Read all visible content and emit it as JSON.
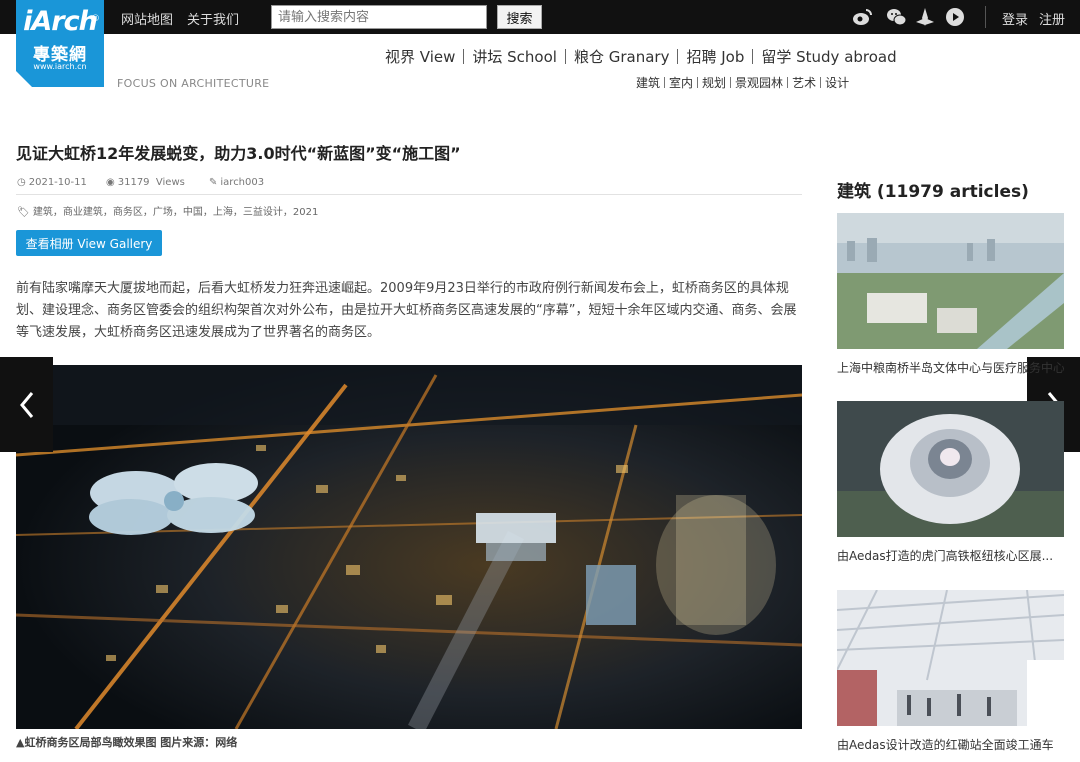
{
  "topbar": {
    "links": [
      "网站地图",
      "关于我们"
    ],
    "search": {
      "placeholder": "请输入搜索内容",
      "value": "",
      "button": "搜索"
    },
    "social_icons": [
      "weibo-icon",
      "wechat-icon",
      "flower-icon",
      "play-icon"
    ],
    "auth": {
      "login": "登录",
      "register": "注册"
    }
  },
  "logo": {
    "brand": "iArch",
    "cn": "專築網",
    "url": "www.iarch.cn",
    "reg": "®"
  },
  "tagline": "FOCUS ON ARCHITECTURE",
  "mainnav": [
    "视界 View",
    "讲坛 School",
    "粮仓 Granary",
    "招聘 Job",
    "留学 Study abroad"
  ],
  "subnav": [
    "建筑",
    "室内",
    "规划",
    "景观园林",
    "艺术",
    "设计"
  ],
  "article": {
    "title": "见证大虹桥12年发展蜕变，助力3.0时代“新蓝图”变“施工图”",
    "date": "2021-10-11",
    "views": "31179",
    "views_label": "Views",
    "author": "iarch003",
    "tags": [
      "建筑",
      "商业建筑",
      "商务区",
      "广场",
      "中国",
      "上海",
      "三益设计",
      "2021"
    ],
    "gallery_button": "查看相册 View Gallery",
    "body": "前有陆家嘴摩天大厦拔地而起，后看大虹桥发力狂奔迅速崛起。2009年9月23日举行的市政府例行新闻发布会上，虹桥商务区的具体规划、建设理念、商务区管委会的组织构架首次对外公布，由是拉开大虹桥商务区高速发展的“序幕”，短短十余年区域内交通、商务、会展等飞速发展，大虹桥商务区迅速发展成为了世界著名的商务区。",
    "caption": "▲虹桥商务区局部鸟瞰效果图 图片来源：网络"
  },
  "sidebar": {
    "heading": "建筑 (11979 articles)",
    "cards": [
      {
        "caption": "上海中粮南桥半岛文体中心与医疗服务中心"
      },
      {
        "caption": "由Aedas打造的虎门高铁枢纽核心区展..."
      },
      {
        "caption": "由Aedas设计改造的红磡站全面竣工通车"
      }
    ]
  },
  "colors": {
    "accent": "#1a96d8",
    "topbar": "#111111"
  }
}
